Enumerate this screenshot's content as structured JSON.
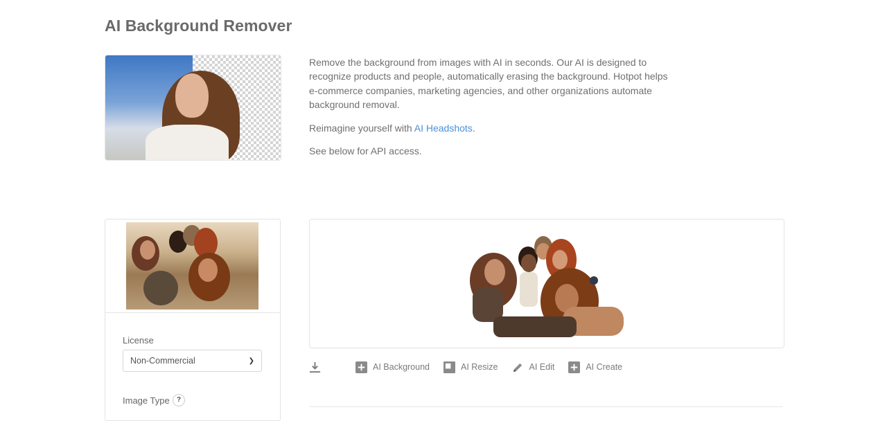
{
  "page": {
    "title": "AI Background Remover"
  },
  "intro": {
    "paragraph1": "Remove the background from images with AI in seconds. Our AI is designed to recognize products and people, automatically erasing the background. Hotpot helps e-commerce companies, marketing agencies, and other organizations automate background removal.",
    "paragraph2_prefix": "Reimagine yourself with ",
    "paragraph2_link": "AI Headshots",
    "paragraph2_suffix": ".",
    "paragraph3": "See below for API access."
  },
  "settings": {
    "license_label": "License",
    "license_value": "Non-Commercial",
    "image_type_label": "Image Type",
    "image_type_help": "?"
  },
  "toolbar": {
    "download_icon": "download-icon",
    "items": [
      {
        "label": "AI Background",
        "icon": "plus-square-icon"
      },
      {
        "label": "AI Resize",
        "icon": "resize-icon"
      },
      {
        "label": "AI Edit",
        "icon": "pencil-icon"
      },
      {
        "label": "AI Create",
        "icon": "plus-square-icon"
      }
    ]
  },
  "colors": {
    "link": "#4a90d9",
    "text": "#6f6f6f",
    "icon": "#7a7a7a"
  }
}
